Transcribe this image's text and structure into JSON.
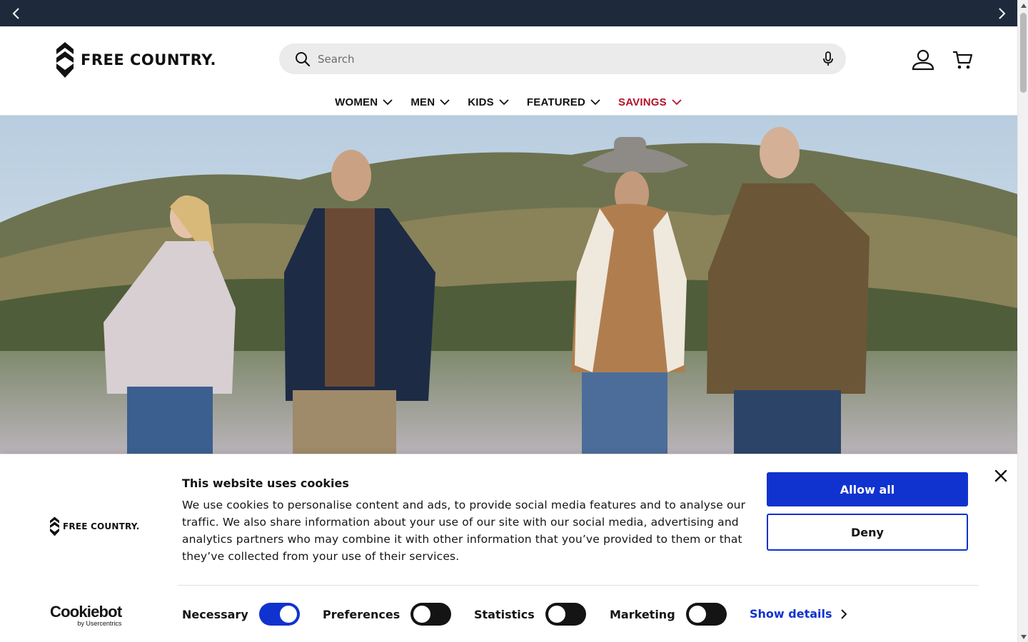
{
  "announcement_bar": {
    "prev_icon": "chevron-left-icon",
    "next_icon": "chevron-right-icon",
    "background": "#1e293b"
  },
  "header": {
    "brand": "FREE COUNTRY.",
    "search": {
      "placeholder": "Search",
      "value": ""
    },
    "account_icon": "user-icon",
    "cart_icon": "cart-icon",
    "nav": [
      {
        "label": "WOMEN"
      },
      {
        "label": "MEN"
      },
      {
        "label": "KIDS"
      },
      {
        "label": "FEATURED"
      },
      {
        "label": "SAVINGS",
        "color": "#b3122a"
      }
    ]
  },
  "cookie_banner": {
    "brand": "FREE COUNTRY.",
    "title": "This website uses cookies",
    "body": "We use cookies to personalise content and ads, to provide social media features and to analyse our traffic. We also share information about your use of our site with our social media, advertising and analytics partners who may combine it with other information that you’ve provided to them or that they’ve collected from your use of their services.",
    "allow_label": "Allow all",
    "deny_label": "Deny",
    "close_icon": "close-icon",
    "provider": "Cookiebot",
    "provider_sub": "by Usercentrics",
    "toggles": [
      {
        "label": "Necessary",
        "on": true
      },
      {
        "label": "Preferences",
        "on": false
      },
      {
        "label": "Statistics",
        "on": false
      },
      {
        "label": "Marketing",
        "on": false
      }
    ],
    "show_details_label": "Show details",
    "accent": "#1032cf"
  }
}
